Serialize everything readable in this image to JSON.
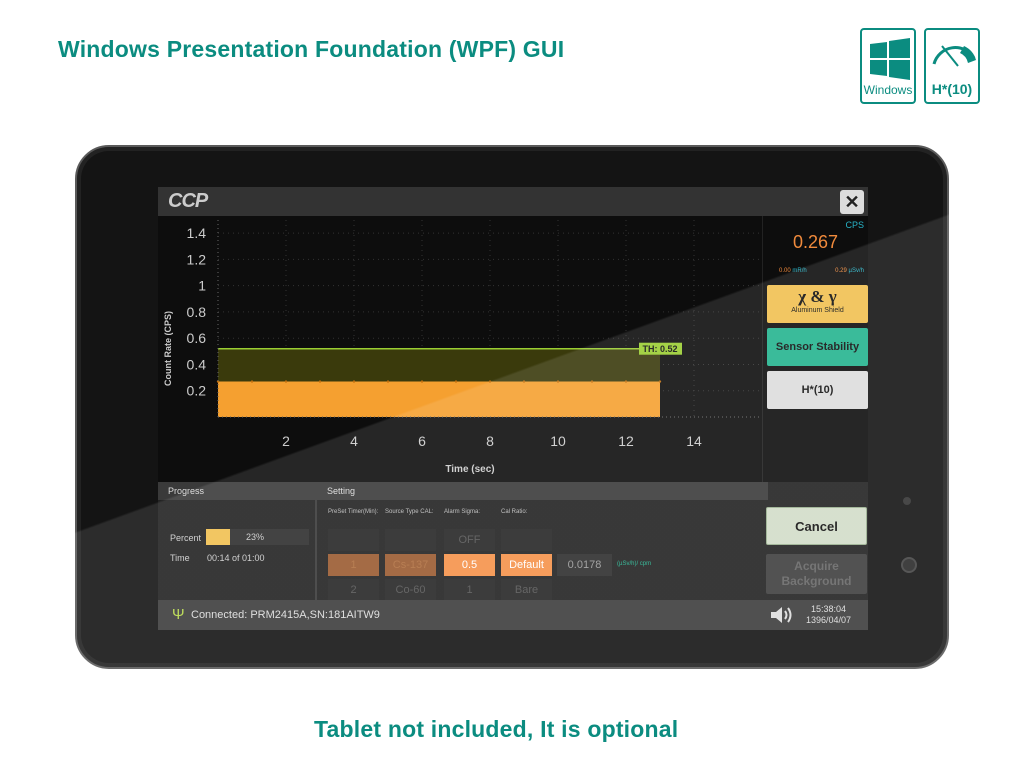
{
  "page": {
    "title": "Windows Presentation Foundation (WPF) GUI",
    "footer": "Tablet not included, It is optional",
    "badges": [
      {
        "label": "Windows",
        "icon": "windows-logo-icon"
      },
      {
        "label": "H*(10)",
        "icon": "gauge-icon"
      }
    ]
  },
  "colors": {
    "brand": "#0b8c80",
    "orange": "#f5a030",
    "threshold": "#9acd32",
    "teal": "#24b38f",
    "yellow": "#f0c050"
  },
  "app": {
    "logo": "CCP",
    "close_label": "✕"
  },
  "reading": {
    "value": "0.267",
    "unit": "CPS",
    "mr_value": "0.00",
    "mr_unit": "mR/h",
    "usv_value": "0.29",
    "usv_unit": "µSv/h"
  },
  "modes": {
    "xg_label": "χ & γ",
    "xg_sub": "Aluminum Shield",
    "stability": "Sensor Stability",
    "h10": "H*(10)"
  },
  "chart_data": {
    "type": "area",
    "xlabel": "Time (sec)",
    "ylabel": "Count Rate (CPS)",
    "xlim": [
      0,
      16
    ],
    "ylim": [
      0,
      1.5
    ],
    "xticks": [
      2,
      4,
      6,
      8,
      10,
      12,
      14
    ],
    "yticks": [
      0.2,
      0.4,
      0.6,
      0.8,
      1.0,
      1.2,
      1.4
    ],
    "series": [
      {
        "x": [
          0,
          1,
          2,
          3,
          4,
          5,
          6,
          7,
          8,
          9,
          10,
          11,
          12,
          13
        ],
        "y": [
          0.27,
          0.27,
          0.27,
          0.27,
          0.27,
          0.27,
          0.27,
          0.27,
          0.27,
          0.27,
          0.27,
          0.27,
          0.27,
          0.27
        ]
      }
    ],
    "threshold": {
      "value": 0.52,
      "label": "TH: 0.52"
    },
    "grid": true
  },
  "progress": {
    "header": "Progress",
    "percent_label": "Percent",
    "percent_value": 23,
    "percent_text": "23%",
    "time_label": "Time",
    "time_value": "00:14 of 01:00"
  },
  "setting": {
    "header": "Setting",
    "columns": [
      {
        "label": "PreSet Timer(Min):",
        "above": "",
        "selected": "1",
        "below": "2"
      },
      {
        "label": "Source Type CAL:",
        "above": "",
        "selected": "Cs-137",
        "below": "Co-60"
      },
      {
        "label": "Alarm Sigma:",
        "above": "OFF",
        "selected": "0.5",
        "below": "1"
      },
      {
        "label": "Cal Ratio:",
        "above": "",
        "selected": "Default",
        "below": "Bare"
      }
    ],
    "ratio_value": "0.0178",
    "ratio_unit": "(µSv/h)/ cpm"
  },
  "actions": {
    "cancel": "Cancel",
    "acquire": "Acquire Background"
  },
  "status": {
    "connection": "Connected: PRM2415A,SN:181AITW9",
    "time": "15:38:04",
    "date": "1396/04/07"
  }
}
